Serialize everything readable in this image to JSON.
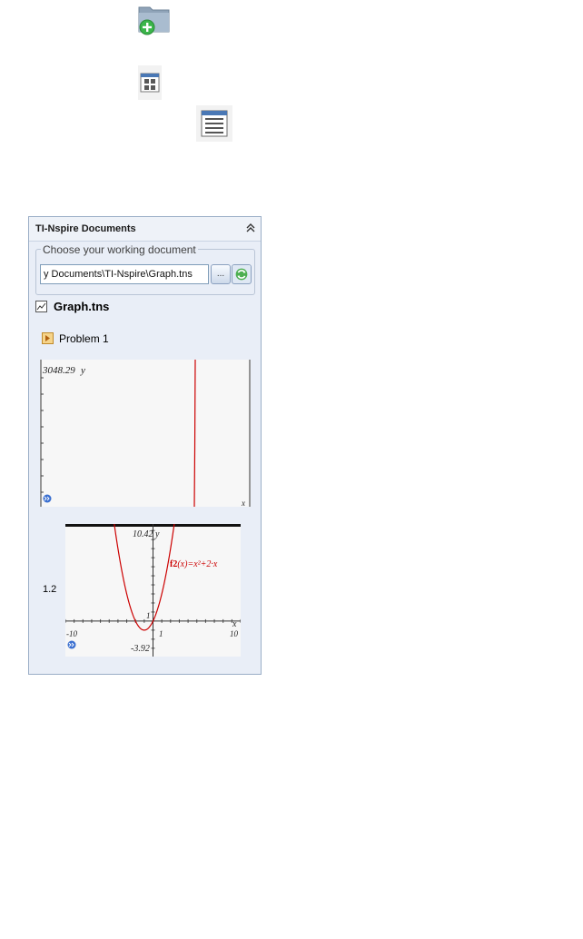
{
  "top_icons": [
    {
      "name": "new-folder-icon"
    },
    {
      "name": "grid-view-icon"
    },
    {
      "name": "list-view-icon"
    }
  ],
  "panel": {
    "title": "TI-Nspire Documents",
    "collapse_icon": "double-chevron-up-icon",
    "group_legend": "Choose your working document",
    "path_value": "y Documents\\TI-Nspire\\Graph.tns",
    "browse_label": "...",
    "document_name": "Graph.tns",
    "problem_label": "Problem 1",
    "page_label": "1.2"
  },
  "graph1": {
    "ymax_label": "3048.29",
    "y_axis_label": "y",
    "x_axis_label": "x"
  },
  "graph2": {
    "ymax_label": "10.42",
    "ymin_label": "-3.92",
    "xmin_label": "-10",
    "xmax_label": "10",
    "x_tick_label": "1",
    "y_tick_label": "1",
    "y_axis_label": "y",
    "x_axis_label": "x",
    "function_name": "f2",
    "function_expr": "(x)=x²+2·x"
  },
  "chart_data": [
    {
      "type": "line",
      "title": "",
      "xlabel": "x",
      "ylabel": "y",
      "ylim": [
        -3.92,
        10.42
      ],
      "xlim": [
        -10,
        10
      ],
      "series": [
        {
          "name": "f2(x)=x²+2·x",
          "expression": "x^2+2*x",
          "color": "#cc0000"
        }
      ]
    }
  ],
  "colors": {
    "panel_bg": "#e9eef7",
    "panel_border": "#9aaec7",
    "curve_red": "#cc0000"
  }
}
